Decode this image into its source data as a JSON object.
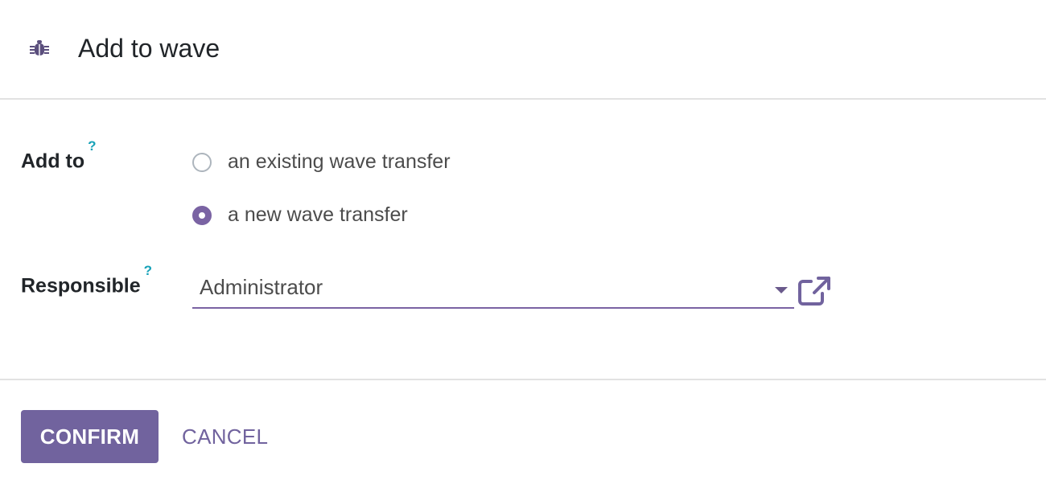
{
  "dialog": {
    "title": "Add to wave",
    "icon": "bug-icon"
  },
  "form": {
    "add_to": {
      "label": "Add to",
      "help_marker": "?",
      "options": [
        {
          "label": "an existing wave transfer",
          "checked": false
        },
        {
          "label": "a new wave transfer",
          "checked": true
        }
      ]
    },
    "responsible": {
      "label": "Responsible",
      "help_marker": "?",
      "value": "Administrator"
    }
  },
  "footer": {
    "confirm_label": "CONFIRM",
    "cancel_label": "CANCEL"
  },
  "colors": {
    "accent": "#71639e",
    "help": "#17a2b8"
  }
}
